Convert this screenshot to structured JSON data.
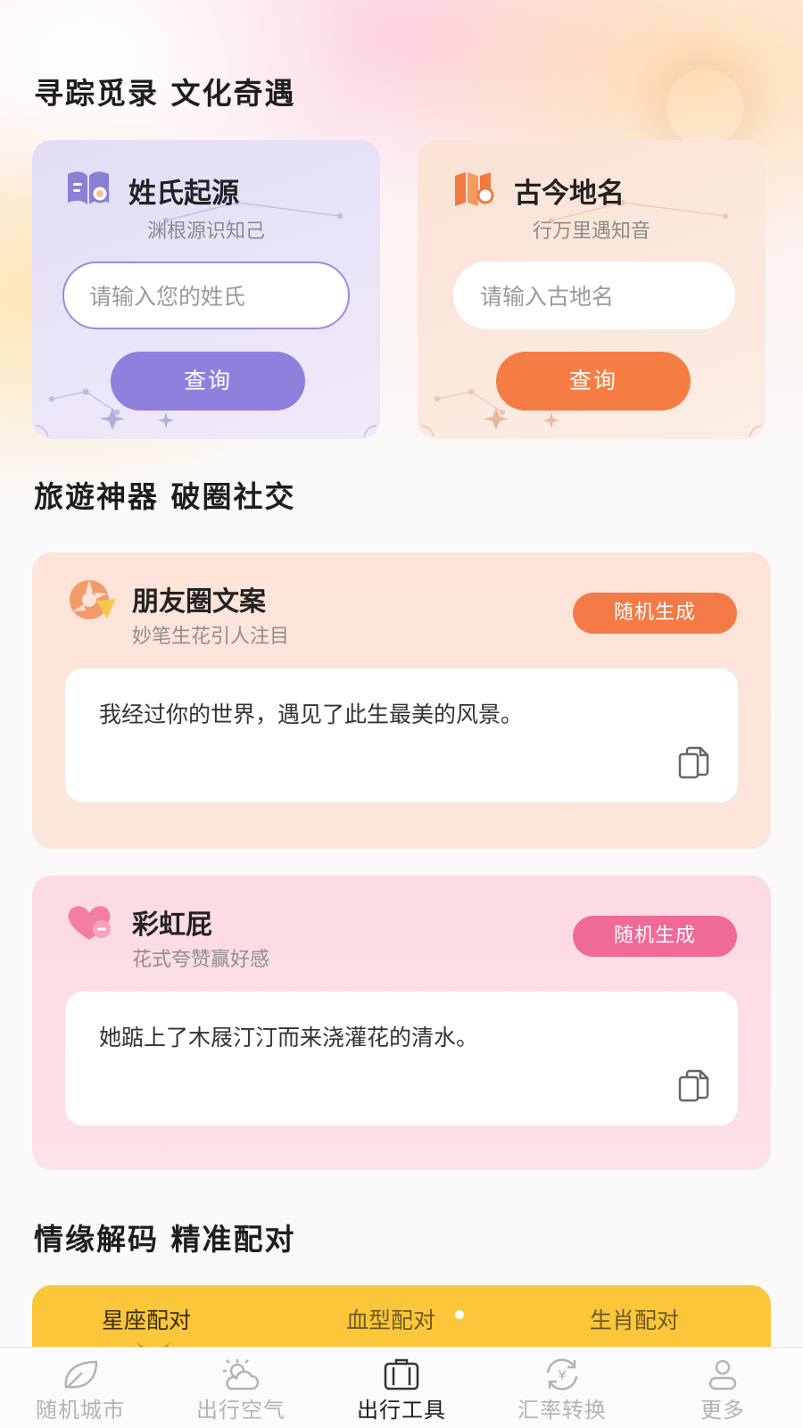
{
  "sections": {
    "culture_title": "寻踪觅录 文化奇遇",
    "social_title": "旅遊神器 破圈社交",
    "match_title": "情缘解码 精准配对"
  },
  "surname_card": {
    "title": "姓氏起源",
    "subtitle": "渊根源识知己",
    "placeholder": "请输入您的姓氏",
    "button": "查询",
    "icon": "book-search-icon"
  },
  "place_card": {
    "title": "古今地名",
    "subtitle": "行万里遇知音",
    "placeholder": "请输入古地名",
    "button": "查询",
    "icon": "map-search-icon"
  },
  "moments_card": {
    "title": "朋友圈文案",
    "subtitle": "妙笔生花引人注目",
    "button": "随机生成",
    "text": "我经过你的世界，遇见了此生最美的风景。",
    "icon": "camera-aperture-icon",
    "accent": "#f47a47"
  },
  "compliment_card": {
    "title": "彩虹屁",
    "subtitle": "花式夸赞赢好感",
    "button": "随机生成",
    "text": "她踮上了木屐汀汀而来浇灌花的清水。",
    "icon": "heart-icon",
    "accent": "#f06a98"
  },
  "match_tabs": [
    "星座配对",
    "血型配对",
    "生肖配对"
  ],
  "nav": [
    {
      "label": "随机城市",
      "icon": "leaf-icon"
    },
    {
      "label": "出行空气",
      "icon": "weather-icon"
    },
    {
      "label": "出行工具",
      "icon": "suitcase-icon",
      "active": true
    },
    {
      "label": "汇率转换",
      "icon": "currency-exchange-icon"
    },
    {
      "label": "更多",
      "icon": "user-icon"
    }
  ]
}
